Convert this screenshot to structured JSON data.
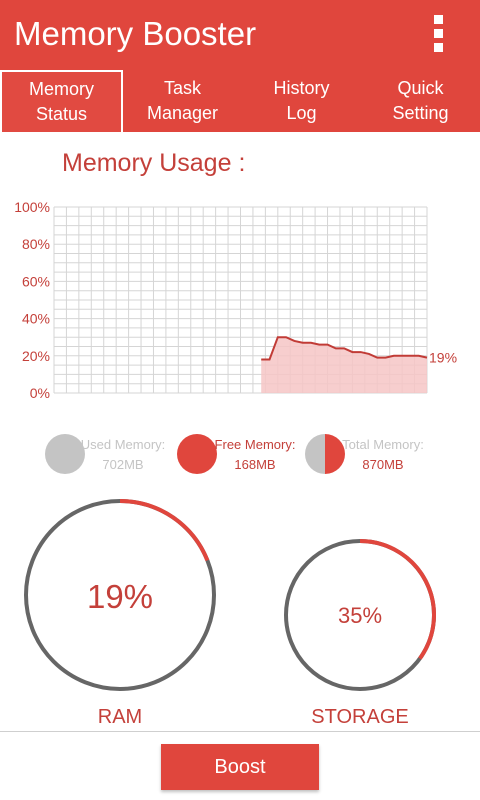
{
  "colors": {
    "accent": "#e0463d",
    "text_red": "#c4403a",
    "gray": "#666666",
    "light_gray": "#c4c4c4",
    "chart_fill": "#f6c6c5",
    "chart_line": "#c13b36",
    "grid": "#d5d5d5"
  },
  "app": {
    "title": "Memory Booster",
    "menu_icon": "overflow-menu-icon"
  },
  "tabs": [
    {
      "line1": "Memory",
      "line2": "Status",
      "active": true
    },
    {
      "line1": "Task",
      "line2": "Manager",
      "active": false
    },
    {
      "line1": "History",
      "line2": "Log",
      "active": false
    },
    {
      "line1": "Quick",
      "line2": "Setting",
      "active": false
    }
  ],
  "memory_usage": {
    "title": "Memory Usage :"
  },
  "chart_data": {
    "type": "area",
    "y_ticks": [
      "100%",
      "80%",
      "60%",
      "40%",
      "20%",
      "0%"
    ],
    "ylim": [
      0,
      100
    ],
    "x_samples": 40,
    "values": [
      null,
      null,
      null,
      null,
      null,
      null,
      null,
      null,
      null,
      null,
      null,
      null,
      null,
      null,
      null,
      null,
      null,
      null,
      null,
      null,
      null,
      null,
      null,
      null,
      null,
      18,
      18,
      30,
      30,
      28,
      27,
      27,
      26,
      26,
      24,
      24,
      22,
      22,
      21,
      19,
      19,
      20,
      20,
      20,
      20,
      19
    ],
    "current_label": "19%"
  },
  "legend": [
    {
      "label": "Used Memory:",
      "value": "702MB",
      "type": "used"
    },
    {
      "label": "Free Memory:",
      "value": "168MB",
      "type": "free"
    },
    {
      "label": "Total Memory:",
      "value": "870MB",
      "type": "total"
    }
  ],
  "gauges": {
    "ram": {
      "percent_text": "19%",
      "fraction": 0.19,
      "label": "RAM"
    },
    "storage": {
      "percent_text": "35%",
      "fraction": 0.35,
      "label": "STORAGE"
    }
  },
  "boost_button": {
    "label": "Boost"
  }
}
